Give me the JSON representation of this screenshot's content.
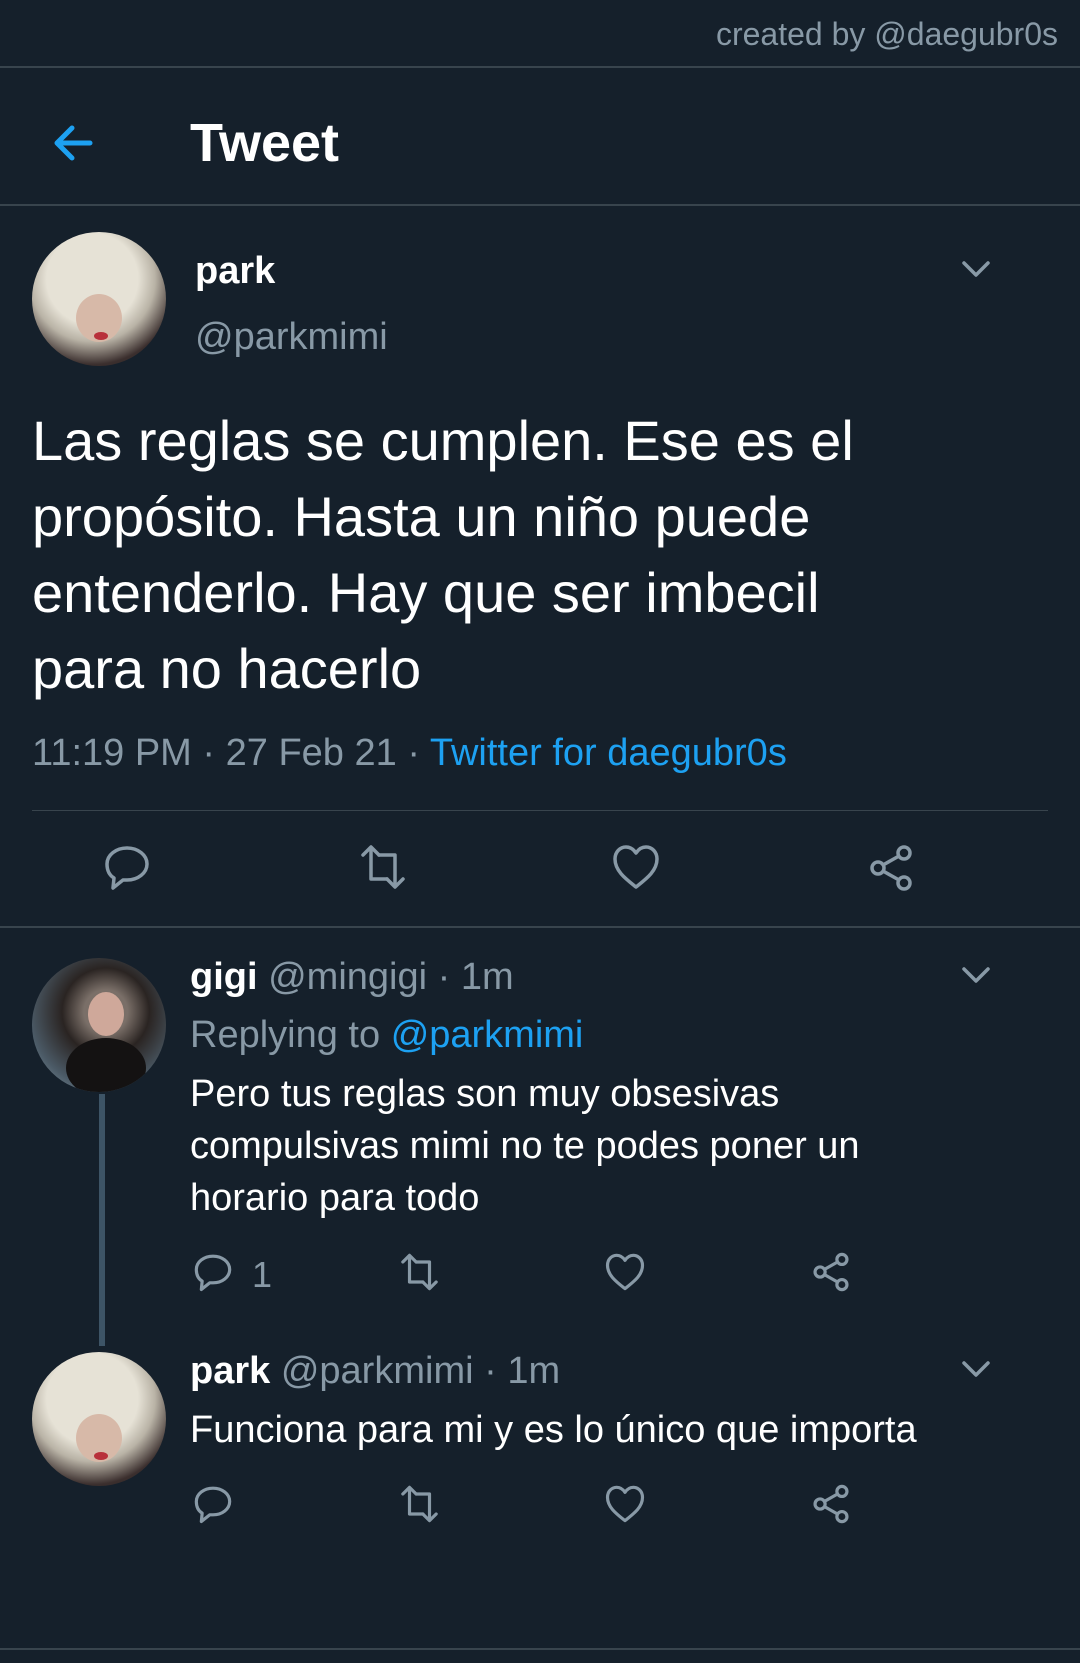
{
  "credit": "created by @daegubr0s",
  "header": {
    "title": "Tweet"
  },
  "main_tweet": {
    "display_name": "park",
    "handle": "@parkmimi",
    "text_lines": [
      "Las reglas se cumplen. Ese es el",
      "propósito. Hasta un niño puede",
      "entenderlo. Hay que ser imbecil",
      "para no hacerlo"
    ],
    "time": "11:19 PM",
    "sep1": "·",
    "date": "27 Feb 21",
    "sep2": "·",
    "client": "Twitter for daegubr0s"
  },
  "replies": [
    {
      "display_name": "gigi",
      "handle": "@mingigi",
      "sep": "·",
      "age": "1m",
      "replying_label": "Replying to",
      "replying_handle": "@parkmimi",
      "text_lines": [
        "Pero tus reglas son muy obsesivas",
        "compulsivas mimi no te podes poner un",
        "horario para todo"
      ],
      "reply_count": "1"
    },
    {
      "display_name": "park",
      "handle": "@parkmimi",
      "sep": "·",
      "age": "1m",
      "text_lines": [
        "Funciona para mi y es lo único que importa"
      ],
      "reply_count": ""
    }
  ],
  "colors": {
    "background": "#15202b",
    "accent": "#1da1f2",
    "muted": "#8899a6",
    "divider": "#38444d"
  }
}
